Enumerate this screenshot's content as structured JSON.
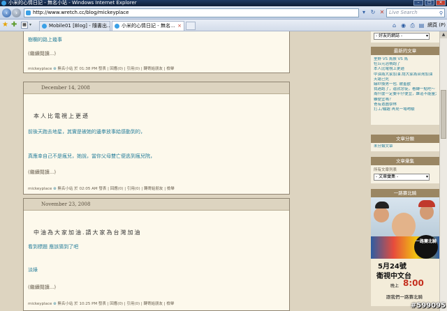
{
  "window": {
    "title": "小米的心情日記 - 無名小站 - Windows Internet Explorer"
  },
  "address": {
    "url": "http://www.wretch.cc/blog/mickeyplace",
    "search_placeholder": "Live Search"
  },
  "tabs": [
    {
      "label": "Mobile01 [Blog] - 隨書出...",
      "active": false
    },
    {
      "label": "小米的心情日記 - 無名...",
      "active": true
    }
  ],
  "command_bar": {
    "page": "網頁 (P)"
  },
  "posts": [
    {
      "link1": "樹欄的路上幾事",
      "more": "(繼續閱讀...)",
      "meta_author": "mickeyplace",
      "meta_site": "無名小站",
      "meta_time": "於 01:38 PM",
      "meta_publish": "發表",
      "meta_rest": "| 回應(0) | 引用(0) | 轉寄給朋友 | 檢舉"
    },
    {
      "date": "December 14, 2008",
      "title": "本人比電視上更遜",
      "link1": "前後天跑去地星，其實是被她的邊拳放事給感動到的，",
      "link2": "真應幸自己不是瘋兒，她說，當你父母雙亡便逃到瘋兒院，",
      "more": "(繼續閱讀...)",
      "meta_author": "mickeyplace",
      "meta_site": "無名小站",
      "meta_time": "於 02:05 AM",
      "meta_publish": "發表",
      "meta_rest": "| 回應(0) | 引用(0) | 轉寄給朋友 | 檢舉"
    },
    {
      "date": "November 23, 2008",
      "title": "中油為大家加油.請大家為台灣加油",
      "link1": "看到標題 應該猜到了吧",
      "link2": "淡綠",
      "more": "(繼續閱讀...)",
      "meta_author": "mickeyplace",
      "meta_site": "無名小站",
      "meta_time": "於 10:25 PM",
      "meta_publish": "發表",
      "meta_rest": "| 回應(0) | 引用(0) | 轉寄給朋友 | 檢舉"
    }
  ],
  "sidebar": {
    "friends_select": "- 好友的網誌 -",
    "latest_heading": "最新的文章",
    "latest_items": [
      "里野 VS 馬猴 VS 馬",
      "牡丘元治禍跑了",
      "本人比電視上更遜",
      "中油為大家加油.請大家為台灣加油",
      "天堪已死",
      "緣紗換男一包. 被羞歡",
      "我過跑了，還就念徒，看轉一點吧～",
      "為什麼一定要平仔便宜，難道不能量大",
      "雖便宜嗎？",
      "爸有遊圖學林",
      "打工/輪趣 再見一場吻驗"
    ],
    "category_heading": "文章分類",
    "category_note": "未分類文章",
    "archive_heading": "文章彙集",
    "archive_note": "所有文章列表",
    "archive_select": "- 文章彙集 -",
    "ad_heading": "一路賽北騎",
    "ad": {
      "circle_text": "一路賽北騎",
      "date": "5月24號",
      "channel": "衛視中文台",
      "time_label": "晚上",
      "time": "8:00",
      "slogan": "跟我們一路賽北騎"
    }
  },
  "watermark": "#599095"
}
